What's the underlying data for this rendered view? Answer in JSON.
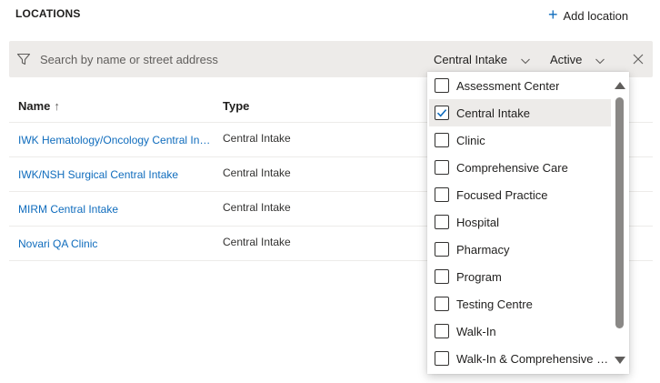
{
  "header": {
    "title": "LOCATIONS",
    "add_label": "Add location"
  },
  "filter": {
    "search_placeholder": "Search by name or street address",
    "type_selected": "Central Intake",
    "status_selected": "Active"
  },
  "table": {
    "columns": [
      "Name",
      "Type"
    ],
    "sort_indicator": "↑",
    "rows": [
      {
        "name": "IWK Hematology/Oncology Central Intake",
        "type": "Central Intake"
      },
      {
        "name": "IWK/NSH Surgical Central Intake",
        "type": "Central Intake"
      },
      {
        "name": "MIRM Central Intake",
        "type": "Central Intake"
      },
      {
        "name": "Novari QA Clinic",
        "type": "Central Intake"
      }
    ]
  },
  "type_dropdown": {
    "options": [
      {
        "label": "Assessment Center",
        "checked": false
      },
      {
        "label": "Central Intake",
        "checked": true
      },
      {
        "label": "Clinic",
        "checked": false
      },
      {
        "label": "Comprehensive Care",
        "checked": false
      },
      {
        "label": "Focused Practice",
        "checked": false
      },
      {
        "label": "Hospital",
        "checked": false
      },
      {
        "label": "Pharmacy",
        "checked": false
      },
      {
        "label": "Program",
        "checked": false
      },
      {
        "label": "Testing Centre",
        "checked": false
      },
      {
        "label": "Walk-In",
        "checked": false
      },
      {
        "label": "Walk-In & Comprehensive Care",
        "checked": false
      }
    ]
  },
  "colors": {
    "link": "#0f6cbd",
    "accent": "#0f6cbd",
    "filter_bar_bg": "#edebe9",
    "selected_option_bg": "#edebe9"
  },
  "icons": {
    "filter": "filter-icon",
    "add": "plus-icon",
    "chevron": "chevron-down-icon",
    "clear": "close-icon",
    "check": "checkmark-icon"
  }
}
